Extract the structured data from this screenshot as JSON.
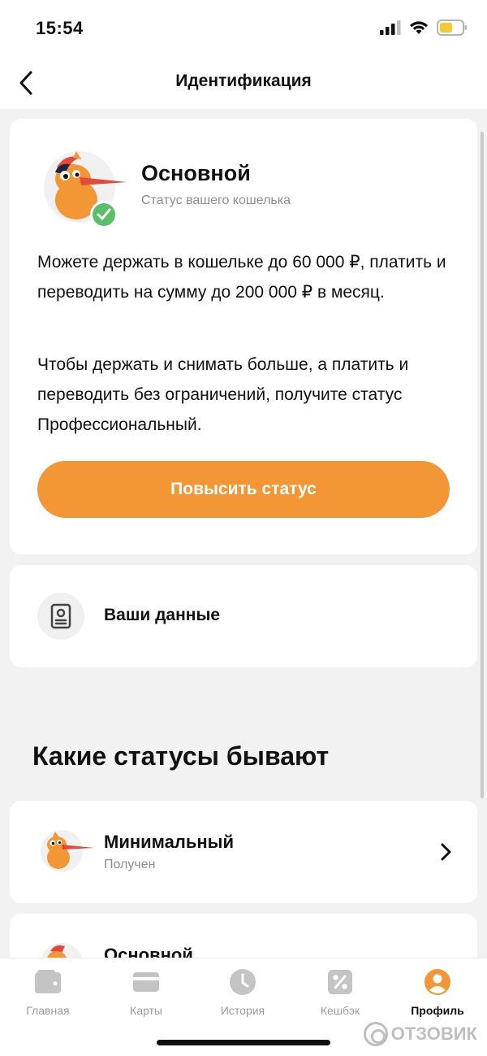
{
  "status_bar": {
    "time": "15:54"
  },
  "header": {
    "title": "Идентификация"
  },
  "status_card": {
    "title": "Основной",
    "subtitle": "Статус вашего кошелька",
    "paragraph1": "Можете держать в кошельке до 60 000 ₽, платить и переводить на сумму до 200 000 ₽ в месяц.",
    "paragraph2": "Чтобы держать и снимать больше, а платить и переводить без ограничений, получите статус Профессиональный.",
    "button_label": "Повысить статус"
  },
  "data_card": {
    "label": "Ваши данные"
  },
  "section": {
    "title": "Какие статусы бывают"
  },
  "statuses": [
    {
      "title": "Минимальный",
      "subtitle": "Получен"
    },
    {
      "title": "Основной"
    }
  ],
  "tabbar": {
    "tabs": [
      {
        "label": "Главная",
        "icon": "wallet-icon"
      },
      {
        "label": "Карты",
        "icon": "card-icon"
      },
      {
        "label": "История",
        "icon": "clock-icon"
      },
      {
        "label": "Кешбэк",
        "icon": "percent-icon"
      },
      {
        "label": "Профиль",
        "icon": "profile-icon",
        "active": true
      }
    ]
  },
  "watermark": {
    "text": "ОТЗОВИК"
  },
  "colors": {
    "accent": "#f29636",
    "check_green": "#5bbf6a",
    "muted": "#8f8f8f"
  }
}
